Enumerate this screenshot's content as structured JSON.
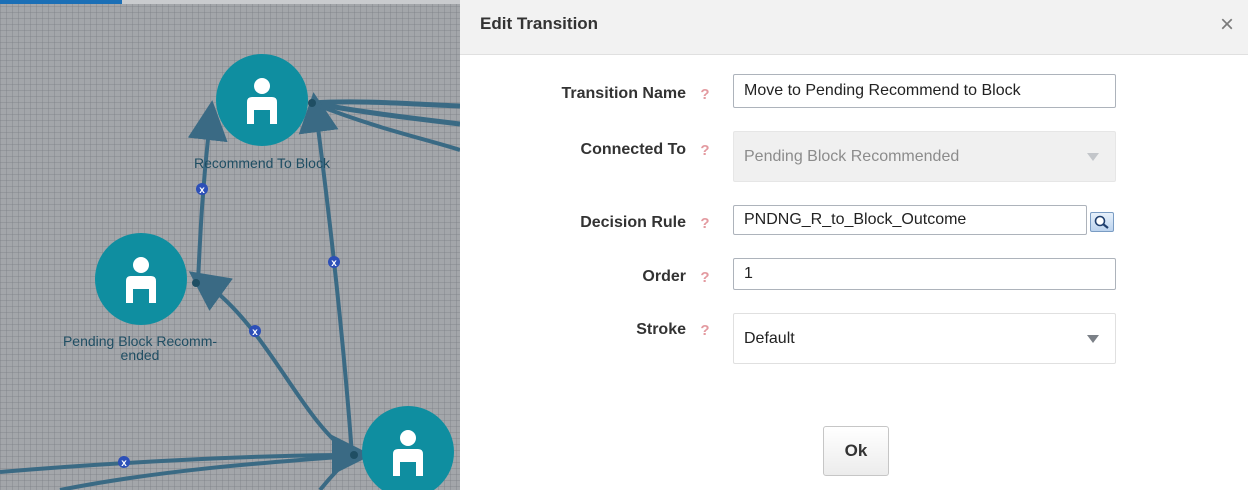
{
  "canvas": {
    "nodes": [
      {
        "label": "Recommend To Block"
      },
      {
        "label": "Pending Block Recomm-\nended"
      },
      {
        "label": ""
      }
    ],
    "edge_marker_glyph": "x",
    "node_icon": "person-icon",
    "colors": {
      "node": "#0f8ea0",
      "edge": "#3a6a84",
      "marker": "#2c4fb8",
      "grid_bg": "#a3a6aa"
    }
  },
  "dialog": {
    "title": "Edit Transition",
    "close_label": "×",
    "help_glyph": "?",
    "fields": {
      "transition_name": {
        "label": "Transition Name",
        "value": "Move to Pending Recommend to Block"
      },
      "connected_to": {
        "label": "Connected To",
        "value": "Pending Block Recommended",
        "disabled": true
      },
      "decision_rule": {
        "label": "Decision Rule",
        "value": "PNDNG_R_to_Block_Outcome"
      },
      "order": {
        "label": "Order",
        "value": "1"
      },
      "stroke": {
        "label": "Stroke",
        "value": "Default"
      }
    },
    "ok_label": "Ok"
  }
}
